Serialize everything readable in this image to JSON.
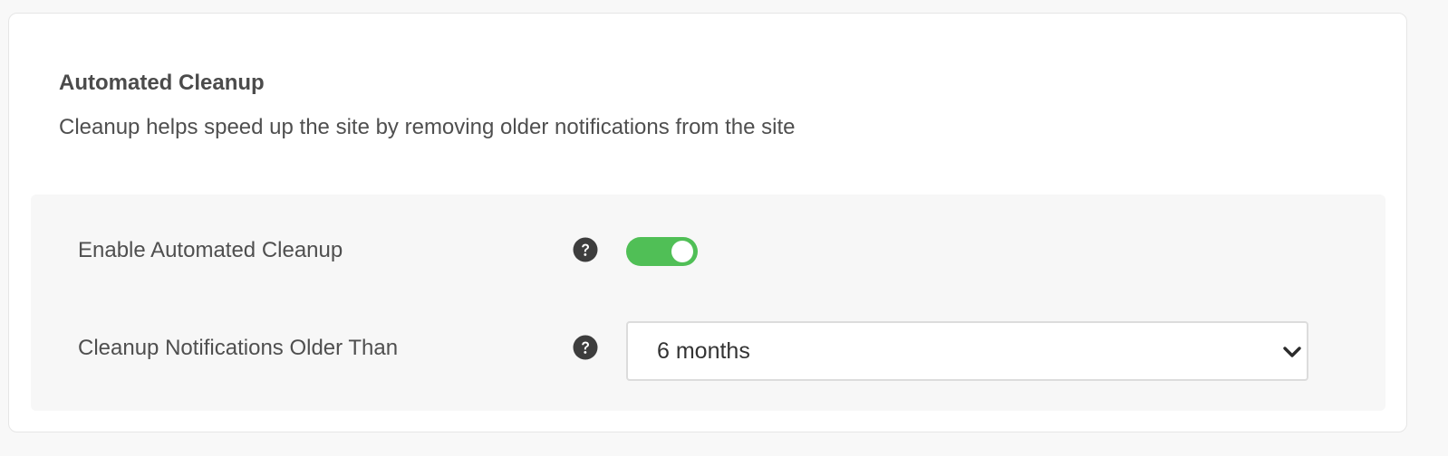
{
  "section": {
    "title": "Automated Cleanup",
    "description": "Cleanup helps speed up the site by removing older notifications from the site"
  },
  "settings": {
    "enable_cleanup": {
      "label": "Enable Automated Cleanup",
      "enabled": true,
      "icon": "help-circle-icon"
    },
    "cleanup_age": {
      "label": "Cleanup Notifications Older Than",
      "selected": "6 months",
      "icon": "help-circle-icon",
      "dropdown_icon": "chevron-down-icon"
    }
  },
  "colors": {
    "toggle_on": "#50bf56",
    "help_icon": "#3d3d3d",
    "text": "#4f4f4f"
  }
}
